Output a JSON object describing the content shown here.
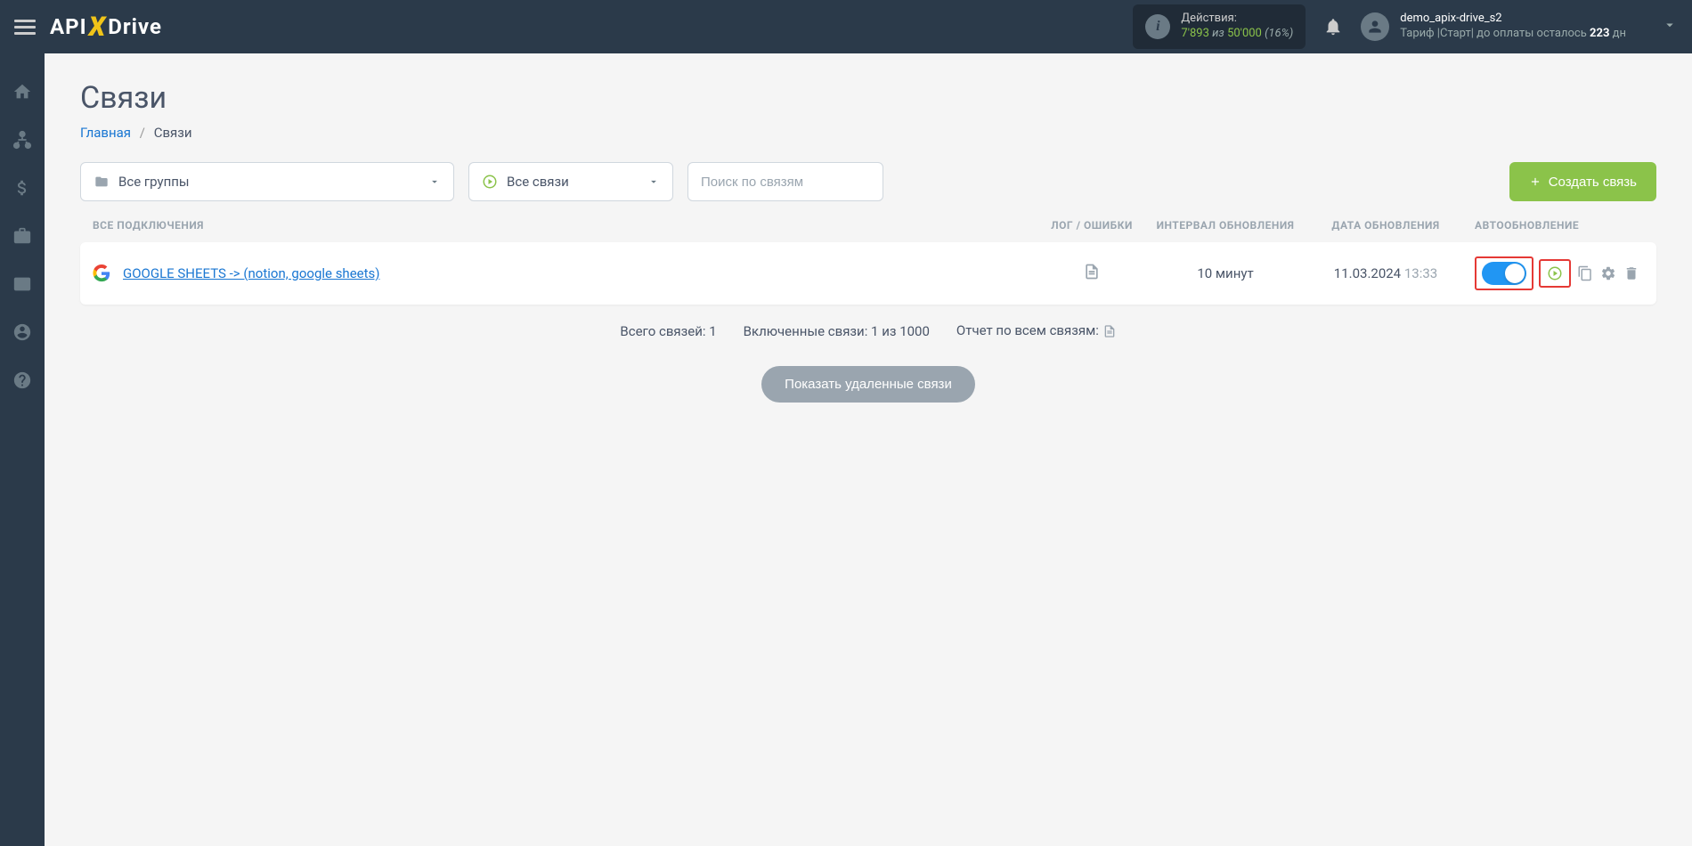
{
  "header": {
    "actions": {
      "label": "Действия:",
      "used": "7'893",
      "of": "из",
      "total": "50'000",
      "percent": "(16%)"
    },
    "user": {
      "name": "demo_apix-drive_s2",
      "tariff_prefix": "Тариф |Старт| до оплаты осталось ",
      "days": "223",
      "days_suffix": " дн"
    }
  },
  "page": {
    "title": "Связи",
    "breadcrumb_home": "Главная",
    "breadcrumb_current": "Связи"
  },
  "filters": {
    "groups_label": "Все группы",
    "status_label": "Все связи",
    "search_placeholder": "Поиск по связям",
    "create_label": "Создать связь"
  },
  "columns": {
    "name": "ВСЕ ПОДКЛЮЧЕНИЯ",
    "log": "ЛОГ / ОШИБКИ",
    "interval": "ИНТЕРВАЛ ОБНОВЛЕНИЯ",
    "date": "ДАТА ОБНОВЛЕНИЯ",
    "auto": "АВТООБНОВЛЕНИЕ"
  },
  "row": {
    "name": "GOOGLE SHEETS -> (notion, google sheets)",
    "interval": "10 минут",
    "date": "11.03.2024",
    "time": "13:33"
  },
  "summary": {
    "total": "Всего связей: 1",
    "enabled": "Включенные связи: 1 из 1000",
    "report": "Отчет по всем связям:"
  },
  "buttons": {
    "show_deleted": "Показать удаленные связи"
  }
}
